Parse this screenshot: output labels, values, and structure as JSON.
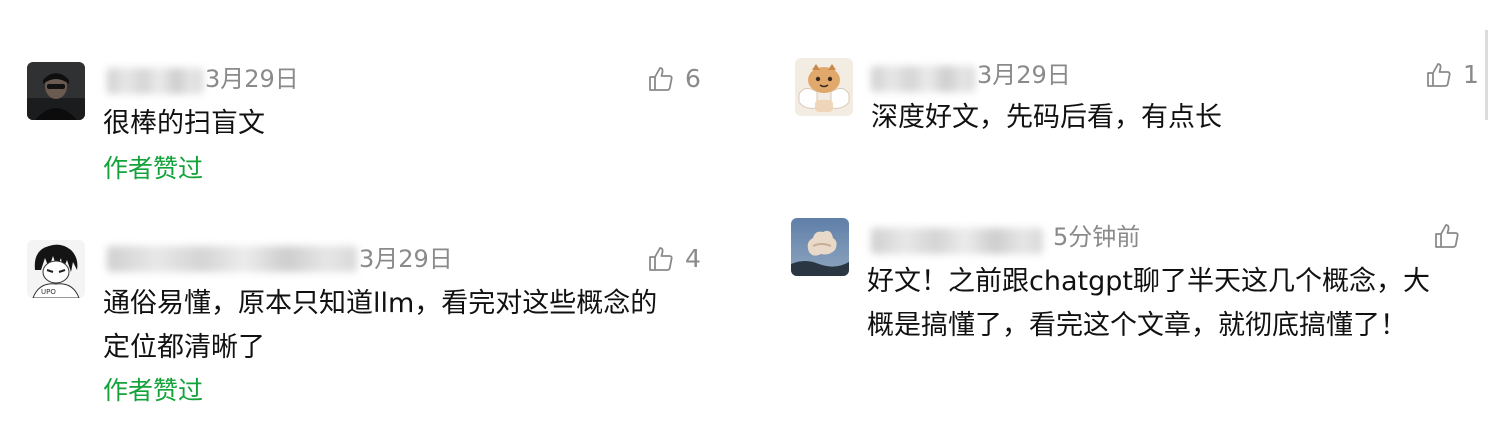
{
  "comments": [
    {
      "time": "3月29日",
      "likes": "6",
      "text_lines": [
        "很棒的扫盲文"
      ],
      "author_liked": "作者赞过"
    },
    {
      "time": "3月29日",
      "likes": "4",
      "text_lines": [
        "通俗易懂，原本只知道llm，看完对这些概念的",
        "定位都清晰了"
      ],
      "author_liked": "作者赞过"
    },
    {
      "time": "3月29日",
      "likes": "1",
      "text_lines": [
        "深度好文，先码后看，有点长"
      ]
    },
    {
      "time": "5分钟前",
      "likes": "",
      "text_lines": [
        "好文！之前跟chatgpt聊了半天这几个概念，大",
        "概是搞懂了，看完这个文章，就彻底搞懂了！"
      ]
    }
  ],
  "icons": {
    "like": "thumb-up-icon"
  },
  "colors": {
    "author_liked": "#13a33a",
    "meta_gray": "#8a8a8a",
    "text": "#111111"
  }
}
